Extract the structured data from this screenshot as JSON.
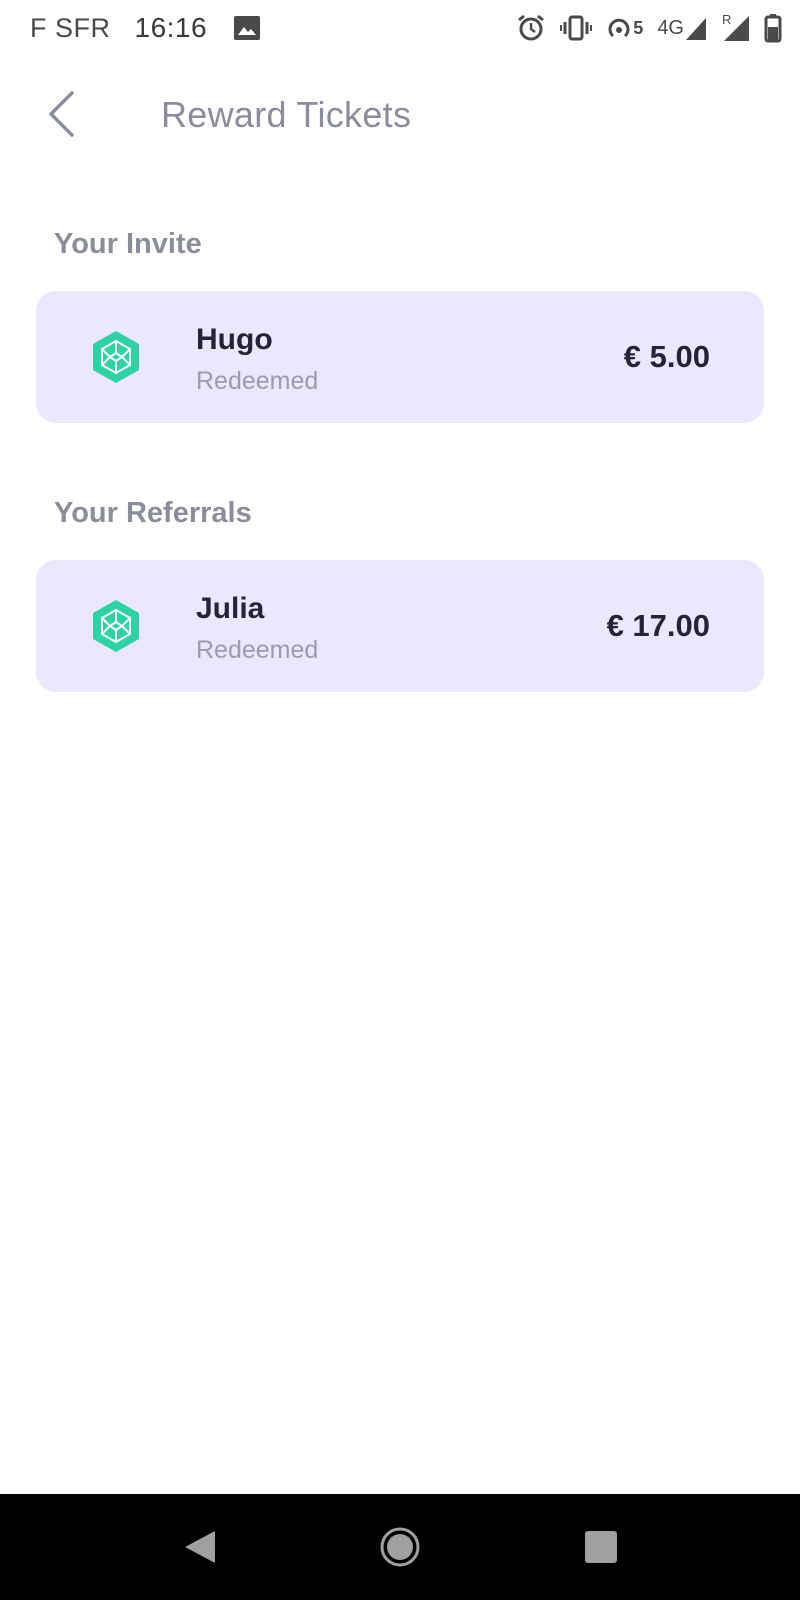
{
  "status_bar": {
    "carrier": "F SFR",
    "time": "16:16",
    "network": "4G",
    "hotspot_count": "5",
    "roaming": "R"
  },
  "header": {
    "title": "Reward Tickets"
  },
  "invite_section": {
    "title": "Your Invite",
    "items": [
      {
        "name": "Hugo",
        "status": "Redeemed",
        "amount": "€ 5.00"
      }
    ]
  },
  "referrals_section": {
    "title": "Your Referrals",
    "items": [
      {
        "name": "Julia",
        "status": "Redeemed",
        "amount": "€ 17.00"
      }
    ]
  },
  "icons": {
    "back": "chevron-left-icon",
    "ticket": "hexagon-logo-icon",
    "nav_back": "triangle-back-icon",
    "nav_home": "circle-home-icon",
    "nav_recents": "square-recents-icon"
  },
  "colors": {
    "card_background": "#ebe7fd",
    "logo_green": "#2ed3a5",
    "title_text": "#8a8d9d",
    "primary_text": "#23243a",
    "secondary_text": "#9a9cad"
  }
}
